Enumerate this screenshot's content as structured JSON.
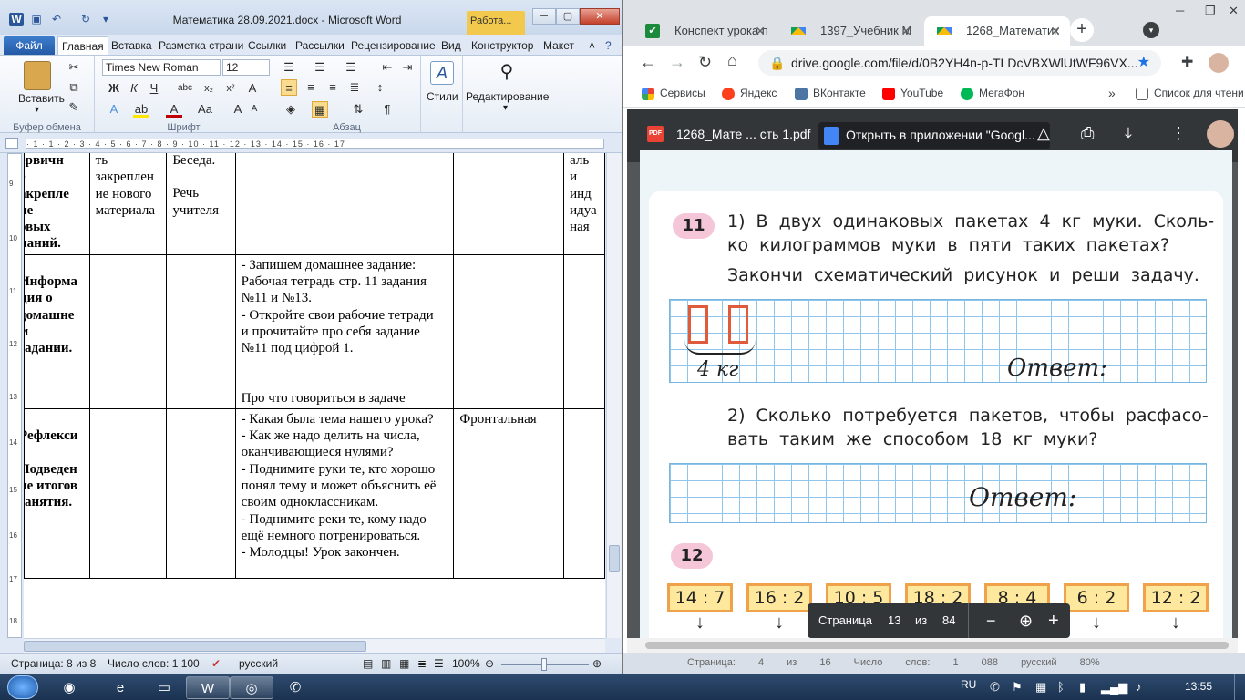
{
  "word": {
    "title": "Математика 28.09.2021.docx  -  Microsoft Word",
    "context_tab": "Работа...",
    "tabs": [
      "Файл",
      "Главная",
      "Вставка",
      "Разметка страни",
      "Ссылки",
      "Рассылки",
      "Рецензирование",
      "Вид",
      "Конструктор",
      "Макет"
    ],
    "font_name": "Times New Roman",
    "font_size": "12",
    "groups": {
      "clipboard": "Буфер обмена",
      "font": "Шрифт",
      "paragraph": "Абзац"
    },
    "paste_label": "Вставить",
    "styles_label": "Стили",
    "editing_label": "Редактирование",
    "ruler_marks": "· 1 · 1 · 2 · 3 · 4 · 5 · 6 · 7 · 8 · 9 · 10 · 11 · 12 · 13 · 14 · 15 · 16 · 17",
    "vruler_marks": [
      "9",
      "10",
      "11",
      "12",
      "13",
      "14",
      "15",
      "16",
      "17",
      "18"
    ],
    "table": {
      "row1": {
        "c1": [
          "ервичн",
          "е",
          "акрепле",
          "ие",
          "овых",
          "наний."
        ],
        "c2": [
          "ть",
          "закреплен",
          "ие нового",
          "материала"
        ],
        "c3": [
          "Беседа.",
          "",
          "Речь",
          "учителя"
        ],
        "c6": [
          "аль",
          "и",
          "инд",
          "идуа",
          "ная"
        ]
      },
      "row2": {
        "c1": [
          ".",
          "Информа",
          "ция о",
          "домашне",
          "м",
          "задании."
        ],
        "c4": [
          " - Запишем домашнее задание:",
          "Рабочая тетрадь стр. 11 задания",
          "№11 и №13.",
          "- Откройте свои рабочие тетради",
          "и прочитайте про себя задание",
          "№11 под цифрой 1.",
          "",
          "",
          "Про что говориться в задаче"
        ]
      },
      "row3": {
        "c1": [
          ".",
          "Рефлекси",
          ".",
          "Подведен",
          "ие итогов",
          "занятия."
        ],
        "c4": [
          "- Какая была тема нашего урока?",
          "- Как же надо делить на числа,",
          "оканчивающиеся нулями?",
          "- Поднимите руки те, кто хорошо",
          "понял тему и может объяснить её",
          "своим одноклассникам.",
          "- Поднимите реки те, кому надо",
          "ещё немного потренироваться.",
          "- Молодцы! Урок закончен."
        ],
        "c5": [
          "Фронтальная"
        ]
      }
    },
    "status": {
      "page": "Страница: 8 из 8",
      "words": "Число слов: 1 100",
      "lang": "русский",
      "zoom": "100%"
    }
  },
  "chrome": {
    "tabs": [
      {
        "label": "Конспект урока п"
      },
      {
        "label": "1397_Учебник М"
      },
      {
        "label": "1268_Математик"
      }
    ],
    "url": "drive.google.com/file/d/0B2YH4n-p-TLDcVBXWlUtWF96VX...",
    "bookmarks": [
      "Сервисы",
      "Яндекс",
      "ВКонтакте",
      "YouTube",
      "МегаФон",
      "Список для чтени"
    ],
    "pdf_name": "1268_Мате ... сть 1.pdf",
    "open_with": "Открыть в приложении \"Googl...",
    "pager": {
      "label": "Страница",
      "current": "13",
      "of": "из",
      "total": "84"
    },
    "pdf": {
      "task11_num": "11",
      "task11_q1_line1": "1) В двух одинаковых пакетах 4 кг муки. Сколь-",
      "task11_q1_line2": "ко килограммов муки в пяти таких пакетах?",
      "task11_q1_line3": "Закончи схематический рисунок и реши задачу.",
      "kg_label": "4 кг",
      "answer_label": "Ответ:",
      "task11_q2_line1": "2) Сколько потребуется пакетов, чтобы расфасо-",
      "task11_q2_line2": "вать таким же способом 18 кг муки?",
      "task12_num": "12",
      "exprs": [
        "14 : 7",
        "16 : 2",
        "10 : 5",
        "18 : 2",
        "8 : 4",
        "6 : 2",
        "12 : 2"
      ]
    },
    "under_text": "Страница: 4 из 16 Число слов: 1 088 русский 80%"
  },
  "taskbar": {
    "lang": "RU",
    "time": "13:55"
  }
}
